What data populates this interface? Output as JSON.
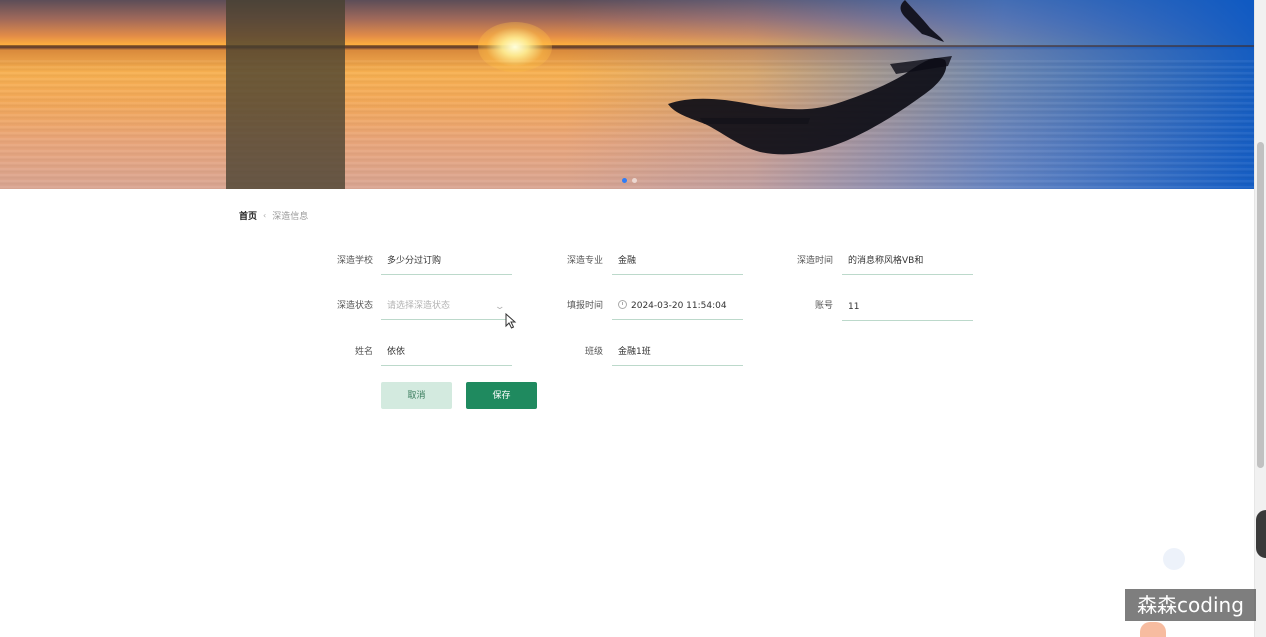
{
  "banner": {
    "slide_count": 2,
    "active_slide": 1
  },
  "breadcrumb": {
    "home": "首页",
    "separator": "‹",
    "current": "深造信息"
  },
  "form": {
    "school": {
      "label": "深造学校",
      "value": "多少分过订购"
    },
    "major": {
      "label": "深造专业",
      "value": "金融"
    },
    "time": {
      "label": "深造时间",
      "value": "的消息称风格VB和"
    },
    "status": {
      "label": "深造状态",
      "placeholder": "请选择深造状态"
    },
    "fill_time": {
      "label": "填报时间",
      "value": "2024-03-20 11:54:04"
    },
    "account": {
      "label": "账号",
      "value": "11"
    },
    "name": {
      "label": "姓名",
      "value": "依依"
    },
    "class": {
      "label": "班级",
      "value": "金融1班"
    },
    "cancel_label": "取消",
    "save_label": "保存"
  },
  "watermark": "森森coding",
  "colors": {
    "primary": "#1f8a5f",
    "cancel_bg": "#d3eadf",
    "input_border": "#bcd9cb",
    "active_dot": "#2f7cf6"
  }
}
